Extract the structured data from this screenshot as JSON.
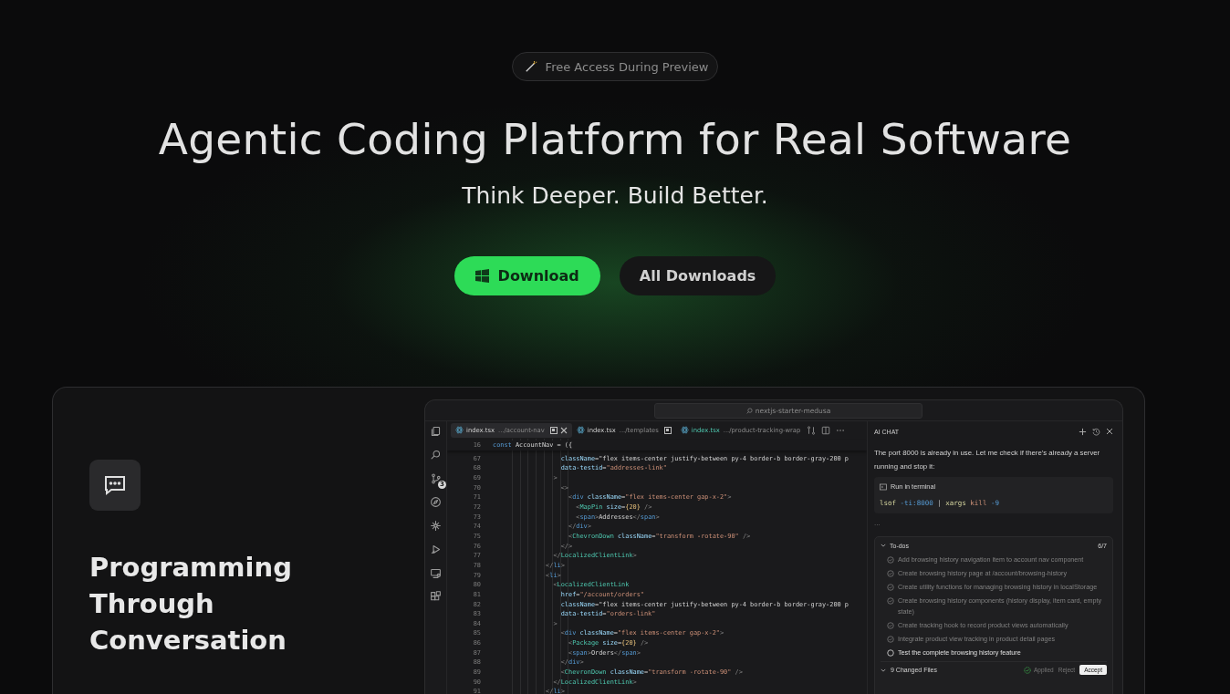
{
  "badge": {
    "text": "Free Access During Preview"
  },
  "hero": {
    "title": "Agentic Coding Platform for Real Software",
    "subtitle": "Think Deeper. Build Better."
  },
  "buttons": [
    {
      "label": "Download",
      "kind": "primary"
    },
    {
      "label": "All Downloads",
      "kind": "secondary"
    }
  ],
  "feature": {
    "title": "Programming Through Conversation"
  },
  "editor": {
    "search": "nextjs-starter-medusa",
    "activity_bar": [
      {
        "kind": "files"
      },
      {
        "kind": "search"
      },
      {
        "kind": "git",
        "badge": "3"
      },
      {
        "kind": "compass"
      },
      {
        "kind": "network"
      },
      {
        "kind": "run"
      },
      {
        "kind": "remote"
      },
      {
        "kind": "extensions"
      }
    ],
    "tabs": [
      {
        "name": "index.tsx",
        "path": ".../account-nav",
        "selected": true,
        "modified": true,
        "added": false
      },
      {
        "name": "index.tsx",
        "path": ".../templates",
        "selected": false,
        "modified": true,
        "added": false
      },
      {
        "name": "index.tsx",
        "path": ".../product-tracking-wrap",
        "selected": false,
        "modified": false,
        "added": true
      }
    ],
    "sticky_line": {
      "number": "16",
      "text": "const AccountNav = ({"
    },
    "lines": [
      {
        "number": "67",
        "text": "                  className=\"flex items-center justify-between py-4 border-b border-gray-200 p"
      },
      {
        "number": "68",
        "text": "                  data-testid=\"addresses-link\""
      },
      {
        "number": "69",
        "text": "                >"
      },
      {
        "number": "70",
        "text": "                  <>"
      },
      {
        "number": "71",
        "text": "                    <div className=\"flex items-center gap-x-2\">"
      },
      {
        "number": "72",
        "text": "                      <MapPin size={20} />"
      },
      {
        "number": "73",
        "text": "                      <span>Addresses</span>"
      },
      {
        "number": "74",
        "text": "                    </div>"
      },
      {
        "number": "75",
        "text": "                    <ChevronDown className=\"transform -rotate-90\" />"
      },
      {
        "number": "76",
        "text": "                  </>"
      },
      {
        "number": "77",
        "text": "                </LocalizedClientLink>"
      },
      {
        "number": "78",
        "text": "              </li>"
      },
      {
        "number": "79",
        "text": "              <li>"
      },
      {
        "number": "80",
        "text": "                <LocalizedClientLink"
      },
      {
        "number": "81",
        "text": "                  href=\"/account/orders\""
      },
      {
        "number": "82",
        "text": "                  className=\"flex items-center justify-between py-4 border-b border-gray-200 p"
      },
      {
        "number": "83",
        "text": "                  data-testid=\"orders-link\""
      },
      {
        "number": "84",
        "text": "                >"
      },
      {
        "number": "85",
        "text": "                  <div className=\"flex items-center gap-x-2\">"
      },
      {
        "number": "86",
        "text": "                    <Package size={20} />"
      },
      {
        "number": "87",
        "text": "                    <span>Orders</span>"
      },
      {
        "number": "88",
        "text": "                  </div>"
      },
      {
        "number": "89",
        "text": "                  <ChevronDown className=\"transform -rotate-90\" />"
      },
      {
        "number": "90",
        "text": "                </LocalizedClientLink>"
      },
      {
        "number": "91",
        "text": "              </li>"
      }
    ]
  },
  "chat": {
    "title": "AI CHAT",
    "message": "The port 8000 is already in use. Let me check if there's already a server running and stop it:",
    "terminal": {
      "label": "Run in terminal",
      "command": "lsof -ti:8000 | xargs kill -9"
    },
    "ellipsis": "...",
    "todos": {
      "title": "To-dos",
      "count": "6/7",
      "items": [
        {
          "text": "Add browsing history navigation item to account nav component",
          "done": true
        },
        {
          "text": "Create browsing history page at /account/browsing-history",
          "done": true
        },
        {
          "text": "Create utility functions for managing browsing history in localStorage",
          "done": true
        },
        {
          "text": "Create browsing history components (history display, item card, empty state)",
          "done": true
        },
        {
          "text": "Create tracking hook to record product views automatically",
          "done": true
        },
        {
          "text": "Integrate product view tracking in product detail pages",
          "done": true
        },
        {
          "text": "Test the complete browsing history feature",
          "done": false
        }
      ]
    },
    "changes": {
      "title": "9 Changed Files",
      "status": "Applied",
      "reject": "Reject",
      "accept": "Accept"
    }
  }
}
